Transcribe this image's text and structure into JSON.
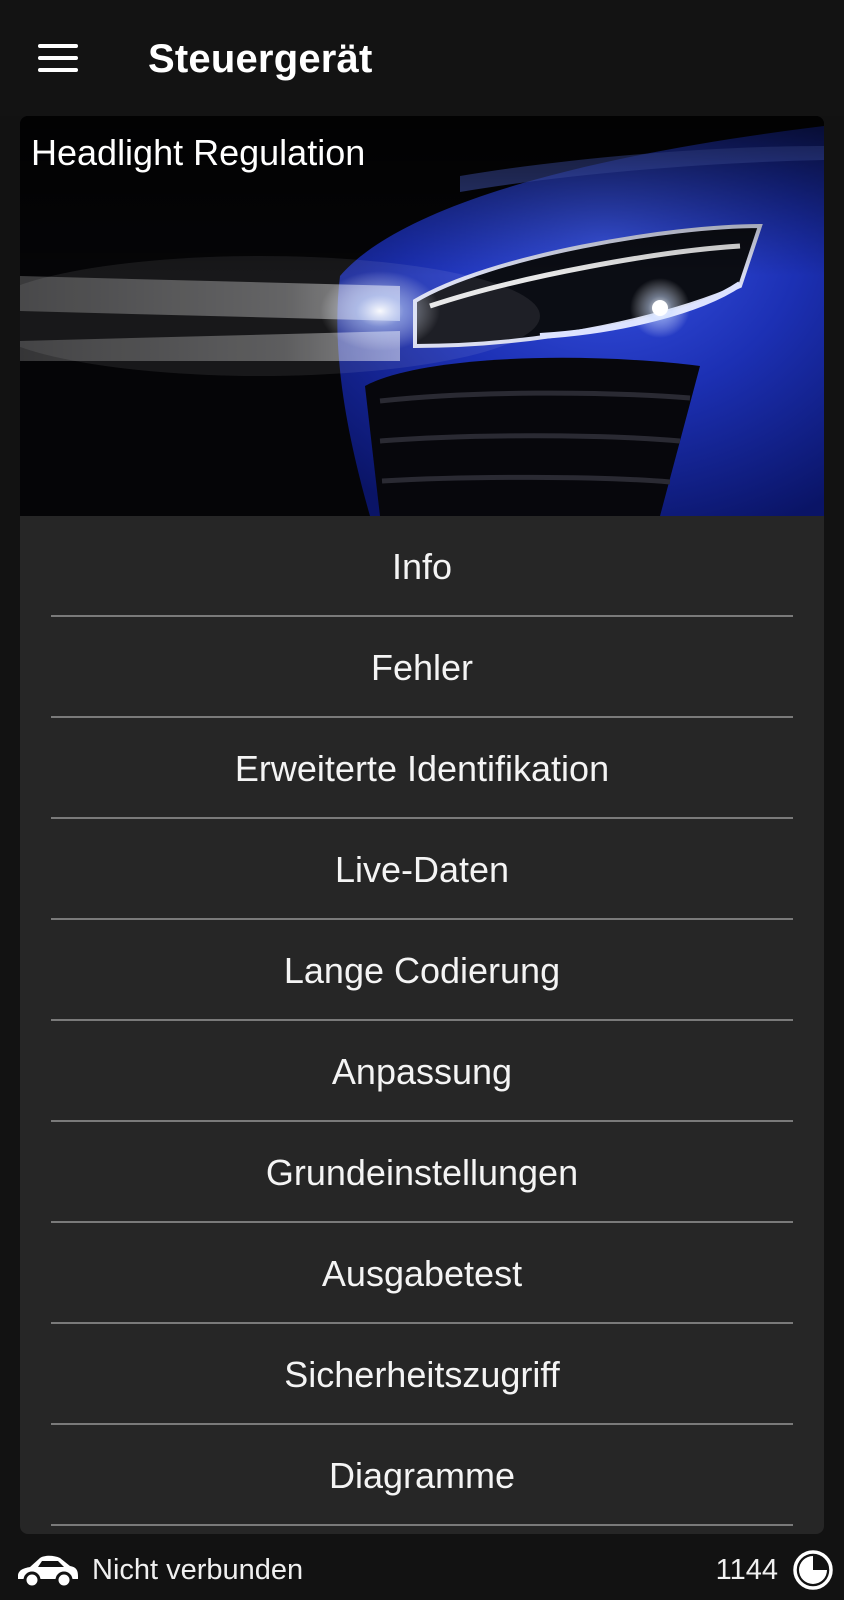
{
  "app_bar": {
    "title": "Steuergerät",
    "menu_icon": "hamburger-menu-icon"
  },
  "module": {
    "name": "Headlight Regulation",
    "image": "car-headlight-photo"
  },
  "menu": {
    "items": [
      {
        "label": "Info"
      },
      {
        "label": "Fehler"
      },
      {
        "label": "Erweiterte Identifikation"
      },
      {
        "label": "Live-Daten"
      },
      {
        "label": "Lange Codierung"
      },
      {
        "label": "Anpassung"
      },
      {
        "label": "Grundeinstellungen"
      },
      {
        "label": "Ausgabetest"
      },
      {
        "label": "Sicherheitszugriff"
      },
      {
        "label": "Diagramme"
      }
    ]
  },
  "status": {
    "connection_icon": "car-icon",
    "connection_text": "Nicht verbunden",
    "count": "1144",
    "count_icon": "credits-icon"
  },
  "colors": {
    "background": "#121212",
    "card": "#262626",
    "divider": "#7a7a7a",
    "car_body": "#1a2fb0"
  }
}
